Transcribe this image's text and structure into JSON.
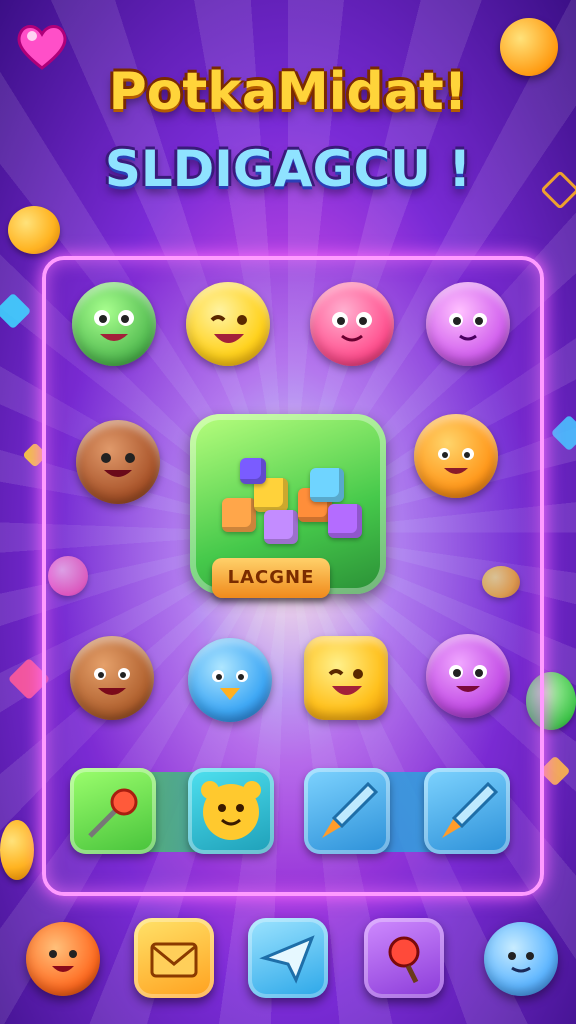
{
  "header": {
    "title_line1": "PotkaMidat!",
    "title_line2": "SLDIGAGCU !"
  },
  "board": {
    "center_label": "LACGNE",
    "grid": [
      {
        "name": "green-monster",
        "color": "#6fd06a"
      },
      {
        "name": "yellow-bear",
        "color": "#ffd23a"
      },
      {
        "name": "pink-cat",
        "color": "#ff5a9a"
      },
      {
        "name": "violet-bear",
        "color": "#d86cf0"
      },
      {
        "name": "brown-bear",
        "color": "#b2602b"
      },
      {
        "name": "orange-fox",
        "color": "#ff9e2c"
      },
      {
        "name": "brown-bear-2",
        "color": "#b86a35"
      },
      {
        "name": "blue-blob",
        "color": "#4ab8ff"
      },
      {
        "name": "yellow-star",
        "color": "#ffc92e"
      },
      {
        "name": "purple-bear",
        "color": "#c74fe6"
      }
    ]
  },
  "tray": {
    "slots": [
      {
        "name": "rocket-pin",
        "color": "#67d84a"
      },
      {
        "name": "yellow-bear",
        "color": "#27b5c9"
      },
      {
        "name": "blue-brush",
        "color": "#2fa7e8"
      },
      {
        "name": "blue-brush-2",
        "color": "#2fa7e8"
      }
    ]
  },
  "bottom_bar": {
    "buttons": [
      {
        "name": "pet-orange",
        "icon": "bear-icon",
        "color": "#ff7a2c"
      },
      {
        "name": "mail-button",
        "icon": "mail-icon",
        "color": "#ffb32c"
      },
      {
        "name": "send-button",
        "icon": "paper-plane-icon",
        "color": "#3bbcf0"
      },
      {
        "name": "boost-button",
        "icon": "magnifier-icon",
        "color": "#a24fe0"
      },
      {
        "name": "pet-blue",
        "icon": "spiky-blob-icon",
        "color": "#5fb6ff"
      }
    ]
  },
  "colors": {
    "accent": "#ff9bff",
    "background": "#7a2bd6"
  }
}
